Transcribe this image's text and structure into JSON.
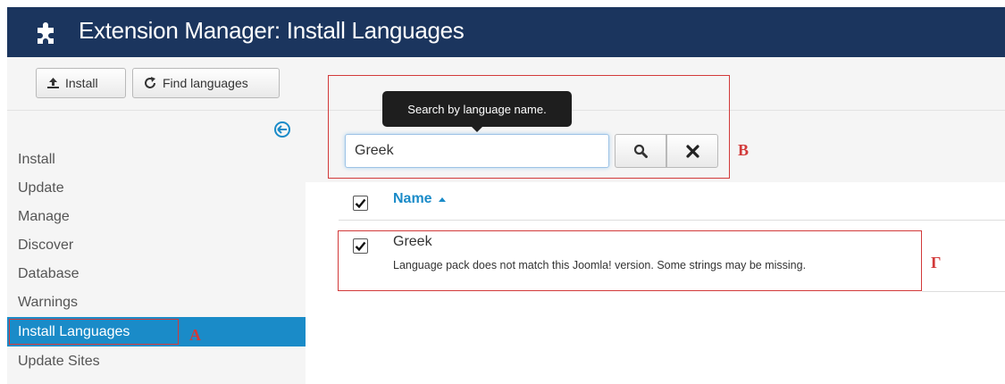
{
  "header": {
    "icon": "puzzle-piece-icon",
    "title": "Extension Manager: Install Languages"
  },
  "toolbar": {
    "install_label": "Install",
    "find_languages_label": "Find languages"
  },
  "sidebar": {
    "items": [
      {
        "label": "Install",
        "active": false
      },
      {
        "label": "Update",
        "active": false
      },
      {
        "label": "Manage",
        "active": false
      },
      {
        "label": "Discover",
        "active": false
      },
      {
        "label": "Database",
        "active": false
      },
      {
        "label": "Warnings",
        "active": false
      },
      {
        "label": "Install Languages",
        "active": true
      },
      {
        "label": "Update Sites",
        "active": false
      }
    ]
  },
  "filter": {
    "tooltip": "Search by language name.",
    "search_value": "Greek"
  },
  "table": {
    "header_checkbox_checked": true,
    "column_name": "Name",
    "rows": [
      {
        "checked": true,
        "name": "Greek",
        "note": "Language pack does not match this Joomla! version. Some strings may be missing."
      }
    ]
  },
  "annotations": {
    "a": "А",
    "b": "B",
    "g": "Γ"
  },
  "colors": {
    "header_bg": "#1b355e",
    "accent": "#1a8bc8",
    "annotation_red": "#d23a3a"
  }
}
